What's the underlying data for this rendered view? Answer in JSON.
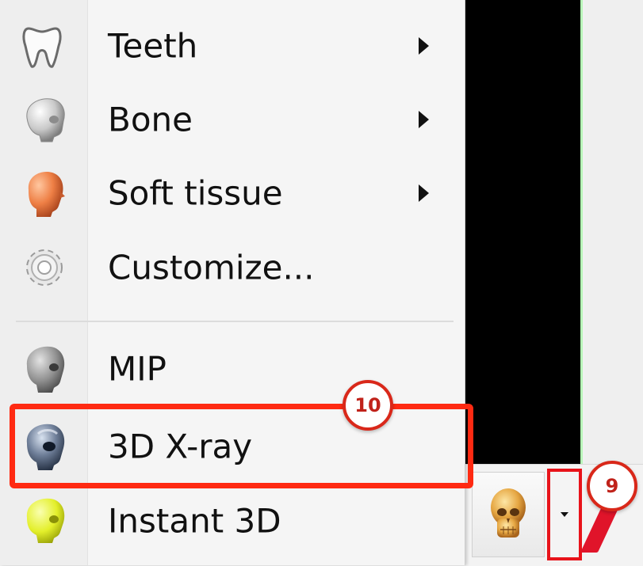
{
  "menu": {
    "items": [
      {
        "label": "Teeth",
        "icon": "tooth-icon",
        "has_submenu": true
      },
      {
        "label": "Bone",
        "icon": "skull-bone-icon",
        "has_submenu": true
      },
      {
        "label": "Soft tissue",
        "icon": "soft-tissue-head-icon",
        "has_submenu": true
      },
      {
        "label": "Customize...",
        "icon": "gear-icon",
        "has_submenu": false
      },
      {
        "label": "MIP",
        "icon": "mip-head-icon",
        "has_submenu": false
      },
      {
        "label": "3D X-ray",
        "icon": "xray-skull-icon",
        "has_submenu": false,
        "highlighted": true
      },
      {
        "label": "Instant 3D",
        "icon": "instant-3d-skull-icon",
        "has_submenu": false
      }
    ]
  },
  "callouts": {
    "c10": "10",
    "c9": "9"
  },
  "toolbar": {
    "render_button_icon": "skull-icon",
    "dropdown_icon": "chevron-down-icon"
  },
  "colors": {
    "highlight": "#ff2a12",
    "callout_border": "#d9281a",
    "viewport": "#000000",
    "viewport_border": "#b7f5b7"
  }
}
